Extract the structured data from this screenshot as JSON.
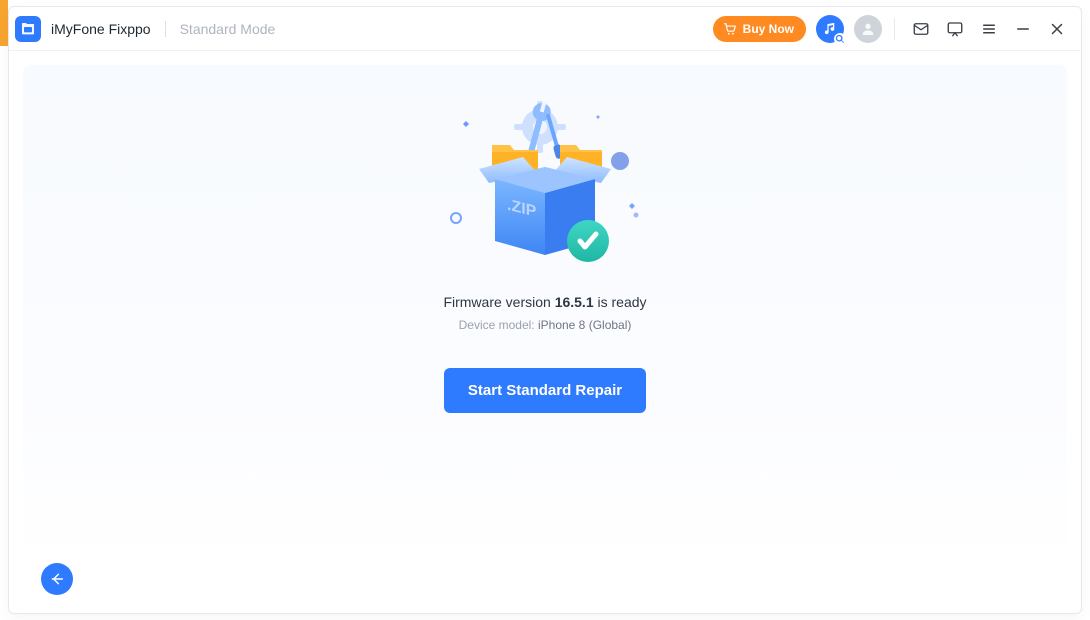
{
  "header": {
    "app_title": "iMyFone Fixppo",
    "mode_label": "Standard Mode",
    "buy_now_label": "Buy Now"
  },
  "main": {
    "firmware_prefix": "Firmware version ",
    "firmware_version": "16.5.1",
    "firmware_suffix": " is ready",
    "device_model_prefix": "Device model: ",
    "device_model": "iPhone 8 (Global)",
    "start_button_label": "Start Standard Repair",
    "box_label": ".ZIP"
  }
}
